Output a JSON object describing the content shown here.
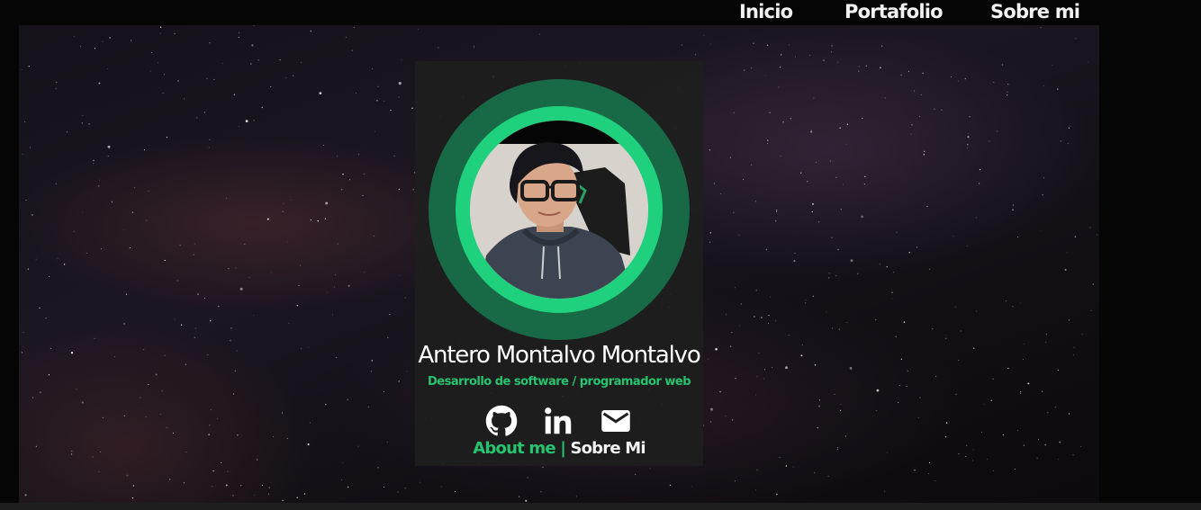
{
  "nav": {
    "items": [
      {
        "label": "Inicio"
      },
      {
        "label": "Portafolio"
      },
      {
        "label": "Sobre mi"
      }
    ]
  },
  "profile": {
    "name": "Antero Montalvo Montalvo",
    "role": "Desarrollo de software / programador web",
    "socials": [
      {
        "icon": "github-icon"
      },
      {
        "icon": "linkedin-icon"
      },
      {
        "icon": "mail-icon"
      }
    ],
    "about": {
      "en": "About me",
      "separator": "|",
      "es": "Sobre Mi"
    }
  },
  "colors": {
    "accent": "#26c46f",
    "ring_outer": "#186a47",
    "ring_inner": "#1fd07c",
    "card_bg": "#1e1e1e",
    "page_bg": "#050505"
  }
}
